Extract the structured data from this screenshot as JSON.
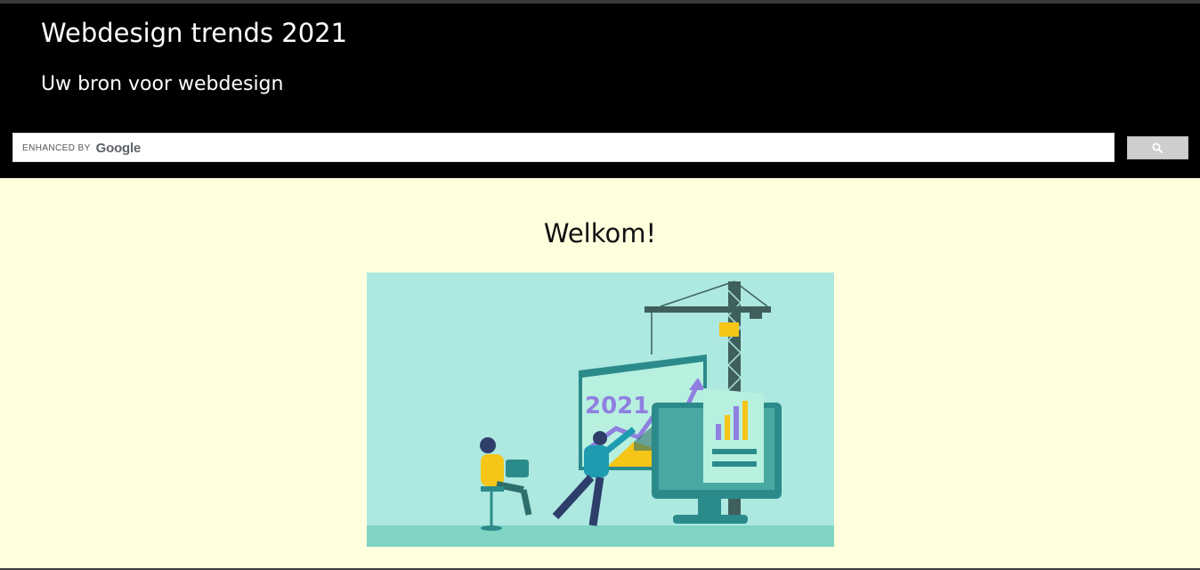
{
  "header": {
    "title": "Webdesign trends 2021",
    "tagline": "Uw bron voor webdesign"
  },
  "search": {
    "enhanced_by_label": "enhanced by",
    "brand": "Google",
    "placeholder": "",
    "button_icon": "search-icon"
  },
  "main": {
    "heading": "Welkom!",
    "hero_chart_label": "2021"
  },
  "colors": {
    "header_bg": "#000000",
    "page_bg": "#ffffde",
    "illustration_bg": "#ade8e1",
    "accent_purple": "#8f7fe0",
    "accent_yellow": "#f5c518",
    "accent_teal": "#2b8b8a"
  }
}
